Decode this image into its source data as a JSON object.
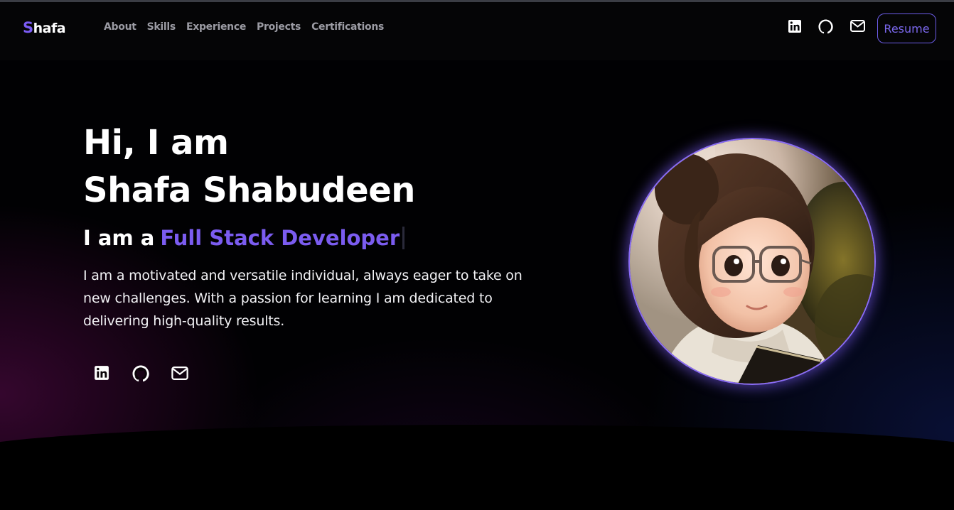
{
  "brand": {
    "first": "S",
    "rest": "hafa"
  },
  "nav": {
    "links": [
      "About",
      "Skills",
      "Experience",
      "Projects",
      "Certifications"
    ],
    "icons": [
      "linkedin-icon",
      "github-icon",
      "mail-icon"
    ],
    "resume_label": "Resume"
  },
  "hero": {
    "greeting": "Hi, I am",
    "name": "Shafa Shabudeen",
    "role_prefix": "I am a",
    "role": "Full Stack Developer",
    "bio": "I am a motivated and versatile individual, always eager to take on new challenges. With a passion for learning I am dedicated to delivering high-quality results.",
    "social_icons": [
      "linkedin-icon",
      "github-icon",
      "mail-icon"
    ]
  },
  "colors": {
    "accent": "#7b5cf0",
    "background": "#000000",
    "nav_text": "#9b9ba3"
  }
}
